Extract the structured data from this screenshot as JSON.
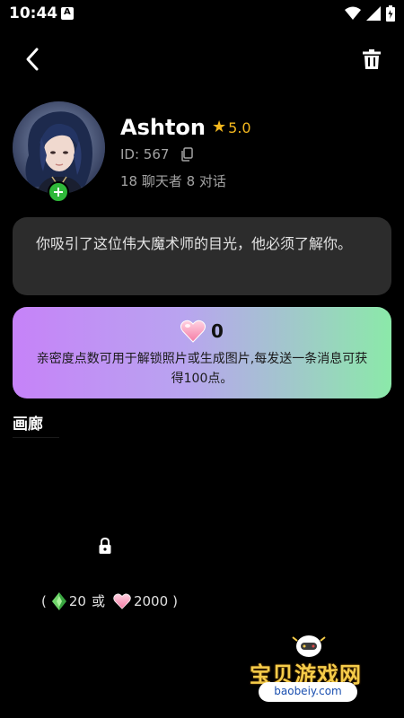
{
  "status_bar": {
    "time": "10:44",
    "notification_icon": "a-notification-icon",
    "wifi_icon": "wifi-icon",
    "signal_icon": "signal-icon",
    "battery_icon": "battery-icon"
  },
  "top_bar": {
    "back_icon": "chevron-left-icon",
    "delete_icon": "trash-icon"
  },
  "profile": {
    "name": "Ashton",
    "rating_icon": "star-icon",
    "rating": "5.0",
    "id_text": "ID: 567",
    "copy_icon": "copy-icon",
    "stats": "18 聊天者 8 对话",
    "add_icon": "plus-icon"
  },
  "description": "你吸引了这位伟大魔术师的目光，他必须了解你。",
  "intimacy": {
    "points": "0",
    "info": "亲密度点数可用于解锁照片或生成图片,每发送一条消息可获得100点。"
  },
  "gallery": {
    "title": "画廊",
    "items": [
      {
        "lock_icon": "lock-icon",
        "open_paren": "(",
        "gem_price": "20",
        "or_text": "或",
        "heart_price": "2000",
        "close_paren": ")"
      }
    ]
  },
  "watermark": {
    "text": "宝贝游戏网",
    "url": "baobeiy.com"
  },
  "colors": {
    "background": "#000000",
    "card": "#2c2c2c",
    "accent_gold": "#f4b81e",
    "add_green": "#2fb83a",
    "gradient_start": "#c682f8",
    "gradient_end": "#8be9a9"
  }
}
